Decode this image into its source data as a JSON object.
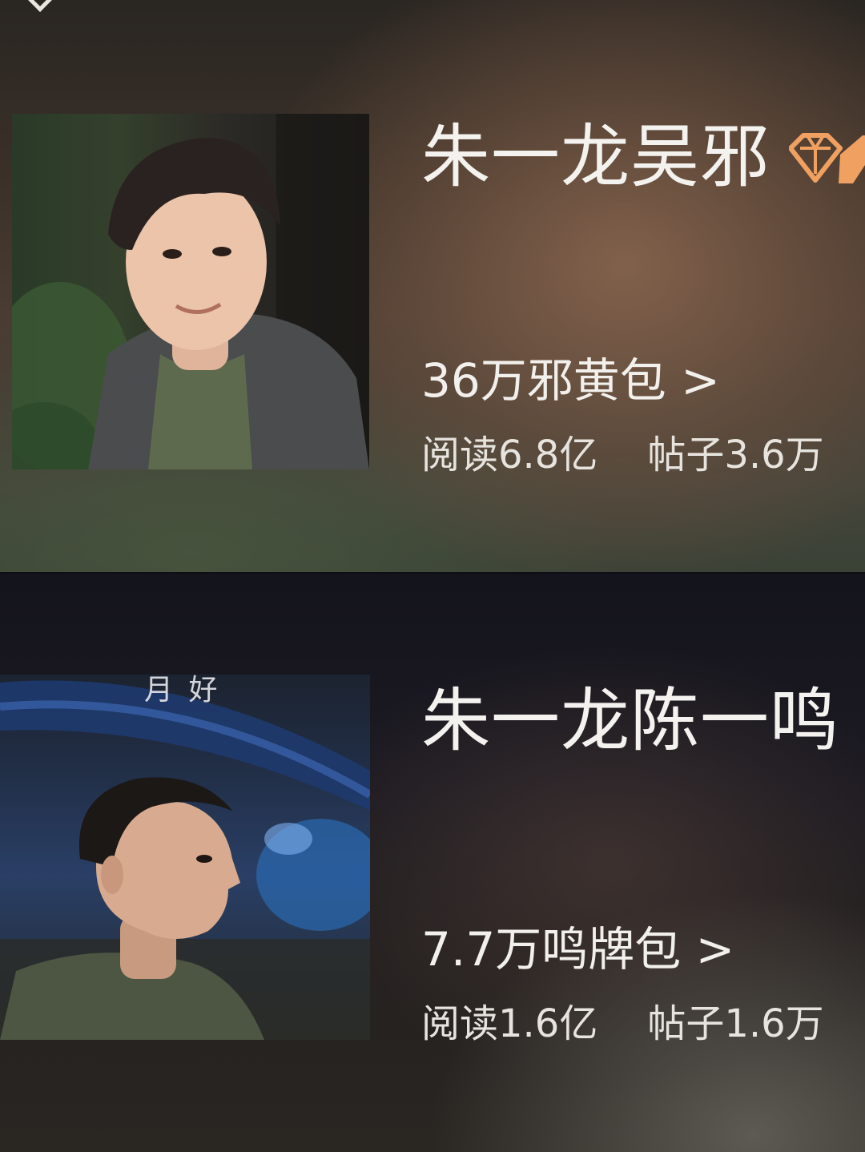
{
  "topics": [
    {
      "title": "朱一龙吴邪",
      "badge_icon": "diamond-badge-icon",
      "fan_group": "36万邪黄包 >",
      "stats": {
        "reads": "阅读6.8亿",
        "posts": "帖子3.6万"
      },
      "poster_caption": ""
    },
    {
      "title": "朱一龙陈一鸣",
      "badge_icon": "",
      "fan_group": "7.7万鸣牌包 >",
      "stats": {
        "reads": "阅读1.6亿",
        "posts": "帖子1.6万"
      },
      "poster_caption": "月 好"
    }
  ],
  "colors": {
    "title_text": "#f4f2ef",
    "badge_orange": "#f0a060"
  }
}
